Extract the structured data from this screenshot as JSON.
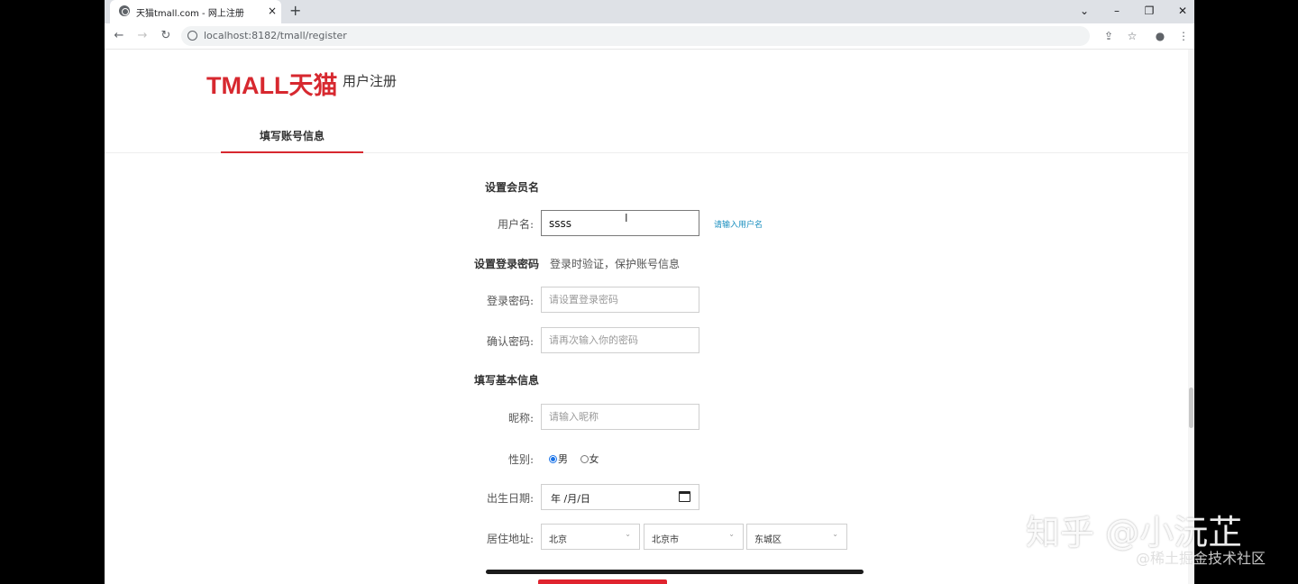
{
  "browser": {
    "tab_title": "天猫tmall.com - 网上注册",
    "tab_close": "×",
    "new_tab": "+",
    "url": "localhost:8182/tmall/register",
    "window_buttons": {
      "down": "⌄",
      "min": "–",
      "max": "❐",
      "close": "✕"
    },
    "icons": [
      "back-icon",
      "forward-icon",
      "reload-icon",
      "share-icon",
      "star-icon",
      "profile-icon",
      "menu-icon"
    ],
    "nav": {
      "back": "←",
      "forward": "→",
      "reload": "↻"
    },
    "toolbar_glyphs": {
      "share": "⇪",
      "star": "☆",
      "profile": "●",
      "menu": "⋮"
    }
  },
  "header": {
    "logo": "TMALL天猫",
    "subtitle": "用户注册"
  },
  "steps": {
    "active": "填写账号信息"
  },
  "account": {
    "section": "设置会员名",
    "username_label": "用户名:",
    "username_value": "ssss",
    "username_hint": "请输入用户名",
    "cursor": "I"
  },
  "password": {
    "section": "设置登录密码",
    "hint": "登录时验证，保护账号信息",
    "login_label": "登录密码:",
    "login_placeholder": "请设置登录密码",
    "confirm_label": "确认密码:",
    "confirm_placeholder": "请再次输入你的密码"
  },
  "basic": {
    "section": "填写基本信息",
    "nickname_label": "昵称:",
    "nickname_placeholder": "请输入昵称",
    "gender_label": "性别:",
    "gender_male": "男",
    "gender_female": "女",
    "birth_label": "出生日期:",
    "birth_value": "年 /月/日",
    "address_label": "居住地址:",
    "province": "北京",
    "city": "北京市",
    "district": "东城区",
    "caret": "⌄"
  },
  "watermark": {
    "main": "知乎 @小沅芷",
    "sub": "@稀土掘金技术社区"
  },
  "colors": {
    "brand_red": "#d7282f",
    "hint_blue": "#1a8fbf",
    "radio_blue": "#1a73e8"
  }
}
